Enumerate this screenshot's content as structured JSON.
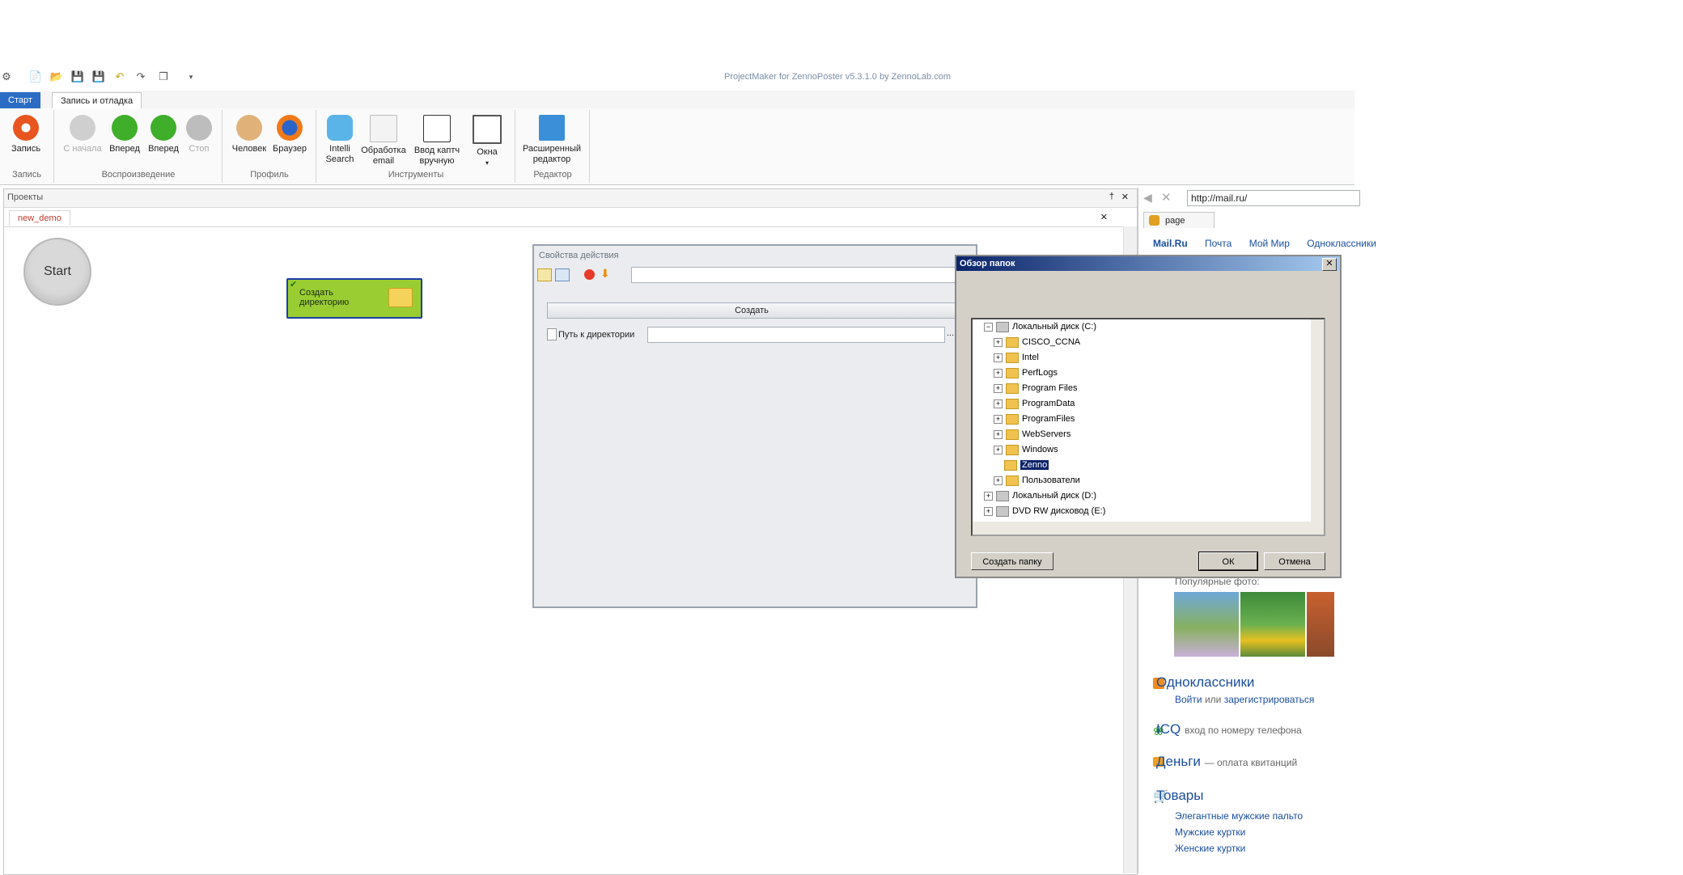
{
  "window": {
    "title": "ProjectMaker for ZennoPoster v5.3.1.0 by ZennoLab.com"
  },
  "ribbon": {
    "tabs": [
      "Старт",
      "Запись и отладка"
    ],
    "buttons": {
      "record": "Запись",
      "from_start": "С начала",
      "forward": "Вперед",
      "forward2": "Вперед",
      "stop": "Стоп",
      "human": "Человек",
      "browser": "Браузер",
      "intelli_1": "Intelli",
      "intelli_2": "Search",
      "email_1": "Обработка",
      "email_2": "email",
      "captcha_1": "Ввод каптч",
      "captcha_2": "вручную",
      "windows": "Окна",
      "adv_1": "Расширенный",
      "adv_2": "редактор"
    },
    "groups": {
      "record": "Запись",
      "playback": "Воспроизведение",
      "profile": "Профиль",
      "tools": "Инструменты",
      "editor": "Редактор"
    }
  },
  "projects": {
    "title": "Проекты",
    "doc_tab": "new_demo",
    "start_node": "Start",
    "action_node": "Создать директорию"
  },
  "props": {
    "title": "Свойства действия",
    "action_button": "Создать",
    "path_label": "Путь к директории",
    "browse": "..."
  },
  "browser": {
    "url": "http://mail.ru/",
    "tab": "page",
    "nav": [
      "Mail.Ru",
      "Почта",
      "Мой Мир",
      "Одноклассники"
    ],
    "popular_photos": "Популярные фото:",
    "odnoklassniki": {
      "title": "Одноклассники",
      "login": "Войти",
      "or": "или",
      "register": "зарегистрироваться"
    },
    "icq": {
      "title": "ICQ",
      "desc": "вход по номеру телефона"
    },
    "money": {
      "title": "Деньги",
      "desc": "— оплата квитанций"
    },
    "goods": {
      "title": "Товары",
      "items": [
        "Элегантные мужские пальто",
        "Мужские куртки",
        "Женские куртки"
      ]
    }
  },
  "dialog": {
    "title": "Обзор папок",
    "tree": [
      "Локальный диск (C:)",
      "CISCO_CCNA",
      "Intel",
      "PerfLogs",
      "Program Files",
      "ProgramData",
      "ProgramFiles",
      "WebServers",
      "Windows",
      "Zenno",
      "Пользователи",
      "Локальный диск (D:)",
      "DVD RW дисковод (E:)"
    ],
    "new_folder": "Создать папку",
    "ok": "ОК",
    "cancel": "Отмена"
  }
}
